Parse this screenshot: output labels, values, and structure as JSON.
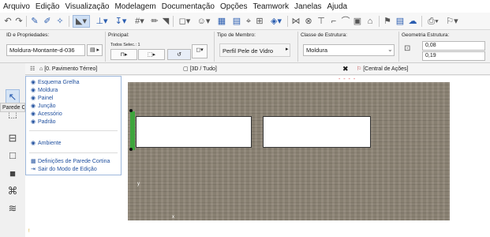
{
  "menu": [
    "Arquivo",
    "Edição",
    "Visualização",
    "Modelagem",
    "Documentação",
    "Opções",
    "Teamwork",
    "Janelas",
    "Ajuda"
  ],
  "infobox": {
    "id_group_title": "ID e Propriedades:",
    "id_value": "Moldura-Montante-d-036",
    "main_group_title": "Principal:",
    "all_selected_label": "Todos Selec.: 1",
    "member_type_title": "Tipo de Membro:",
    "member_type_value": "Perfil Pele de Vidro",
    "structure_class_title": "Classe de Estrutura:",
    "structure_class_value": "Moldura",
    "geometry_title": "Geometria Estrutura:",
    "geometry_width": "0,08",
    "geometry_depth": "0,19"
  },
  "tabs": {
    "floor_plan": "[0. Pavimento Térreo]",
    "view3d": "[3D / Tudo]",
    "actions_center": "[Central de Ações]"
  },
  "side_label": "Parede C",
  "context_menu": {
    "items_top": [
      {
        "icon": "eye",
        "label": "Esquema Grelha"
      },
      {
        "icon": "eye",
        "label": "Moldura"
      },
      {
        "icon": "eye",
        "label": "Painel"
      },
      {
        "icon": "eye",
        "label": "Junção"
      },
      {
        "icon": "eye",
        "label": "Acessório"
      },
      {
        "icon": "eye",
        "label": "Padrão"
      }
    ],
    "item_env": {
      "icon": "eye",
      "label": "Ambiente"
    },
    "items_bottom": [
      {
        "icon": "settings",
        "label": "Definições de Parede Cortina"
      },
      {
        "icon": "exit",
        "label": "Sair do Modo de Edição"
      }
    ]
  },
  "axis": {
    "y": "y",
    "x": "x"
  },
  "colors": {
    "accent": "#2a5db0",
    "selected_member": "#3da53c",
    "wall": "#8a8172"
  }
}
